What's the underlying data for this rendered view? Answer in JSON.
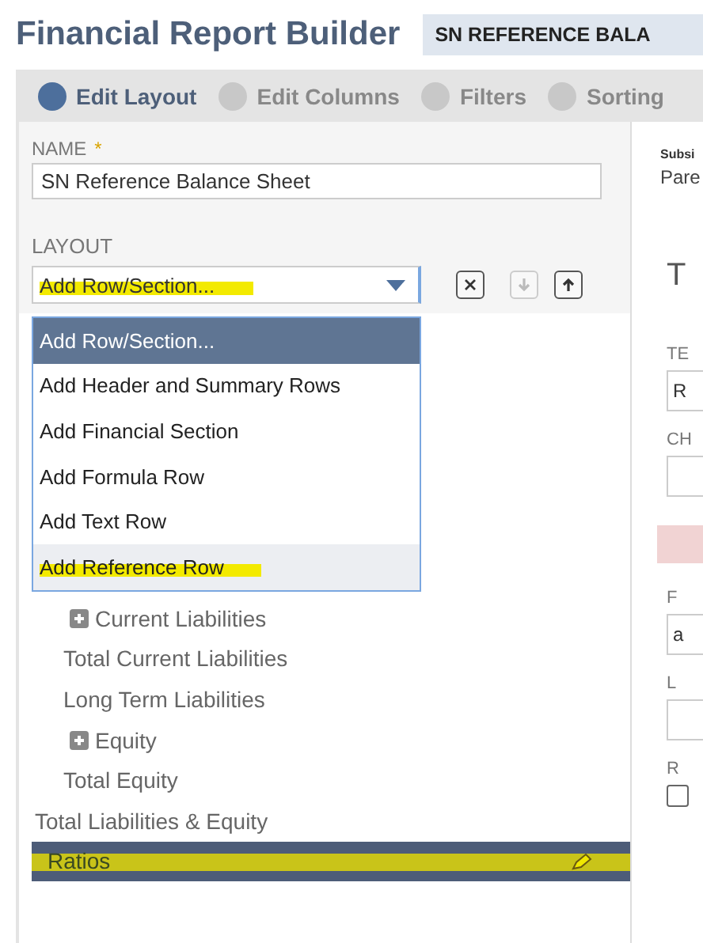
{
  "page_title": "Financial Report Builder",
  "record_badge": "SN REFERENCE BALA",
  "steps": [
    {
      "label": "Edit Layout",
      "selected": true
    },
    {
      "label": "Edit Columns",
      "selected": false
    },
    {
      "label": "Filters",
      "selected": false
    },
    {
      "label": "Sorting",
      "selected": false
    }
  ],
  "name_field": {
    "label": "NAME",
    "required_mark": "*",
    "value": "SN Reference Balance Sheet"
  },
  "subsidiary": {
    "label": "Subsi",
    "value": "Pare"
  },
  "layout": {
    "label": "LAYOUT",
    "select": {
      "value": "Add Row/Section...",
      "highlighted": true
    },
    "tools": [
      {
        "kind": "remove",
        "disabled": false
      },
      {
        "kind": "down",
        "disabled": true
      },
      {
        "kind": "up",
        "disabled": false
      }
    ],
    "options": [
      {
        "label": "Add Row/Section...",
        "selected": true,
        "highlighted": false
      },
      {
        "label": "Add Header and Summary Rows",
        "selected": false,
        "highlighted": false
      },
      {
        "label": "Add Financial Section",
        "selected": false,
        "highlighted": false
      },
      {
        "label": "Add Formula Row",
        "selected": false,
        "highlighted": false
      },
      {
        "label": "Add Text Row",
        "selected": false,
        "highlighted": false
      },
      {
        "label": "Add Reference Row",
        "selected": false,
        "highlighted": true
      }
    ],
    "tree": [
      {
        "children": [
          {
            "label": "Current Liabilities",
            "expanded": false,
            "selected": false,
            "highlighted": false
          },
          {
            "label": "Total Current Liabilities",
            "selected": false,
            "highlighted": false
          },
          {
            "label": "Long Term Liabilities",
            "selected": false,
            "highlighted": false
          },
          {
            "label": "Equity",
            "expanded": false,
            "selected": false,
            "highlighted": false
          },
          {
            "label": "Total Equity",
            "selected": false,
            "highlighted": false
          }
        ]
      },
      {
        "label": "Total Liabilities & Equity",
        "selected": false,
        "highlighted": false
      },
      {
        "label": "Ratios",
        "selected": true,
        "highlighted": true
      }
    ]
  },
  "detail_panel": {
    "heading": "T",
    "fields": [
      {
        "kind": "text",
        "label": "TE",
        "value": "R"
      },
      {
        "kind": "text",
        "label": "CH"
      },
      {
        "kind": "notice"
      },
      {
        "kind": "text",
        "label": "F",
        "value": "a"
      },
      {
        "kind": "text",
        "label": "L"
      },
      {
        "kind": "check",
        "label": "R",
        "checked": false
      }
    ]
  }
}
